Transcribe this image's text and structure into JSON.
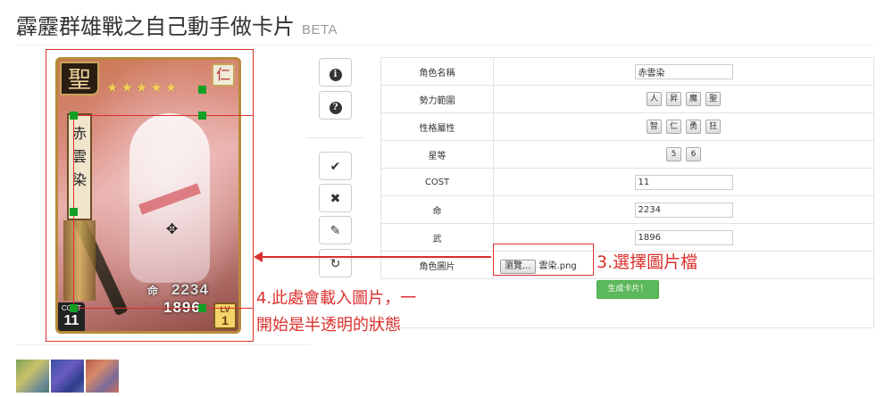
{
  "header": {
    "title": "霹靂群雄戰之自己動手做卡片",
    "badge": "BETA"
  },
  "card": {
    "holy_badge": "聖",
    "trait_badge": "仁",
    "stars": "★★★★★",
    "name_chars": [
      "赤",
      "雲",
      "染"
    ],
    "life_label": "命",
    "life_value": "2234",
    "attack_value": "1896",
    "cost_label": "COST",
    "cost_value": "11",
    "lv_label": "LV",
    "lv_value": "1"
  },
  "tools": {
    "info_icon": "info-icon",
    "help_icon": "help-icon",
    "confirm_icon": "check-icon",
    "cancel_icon": "close-icon",
    "edit_icon": "pencil-icon",
    "reset_icon": "refresh-icon"
  },
  "form": {
    "name_label": "角色名稱",
    "name_value": "赤雲染",
    "faction_label": "勢力範圍",
    "faction_options": [
      "人",
      "昇",
      "魔",
      "聖"
    ],
    "trait_label": "性格屬性",
    "trait_options": [
      "智",
      "仁",
      "勇",
      "狂"
    ],
    "rank_label": "星等",
    "rank_options": [
      "5",
      "6"
    ],
    "cost_label": "COST",
    "cost_value": "11",
    "life_label": "命",
    "life_value": "2234",
    "attack_label": "武",
    "attack_value": "1896",
    "image_label": "角色圖片",
    "browse_label": "瀏覽...",
    "file_name": "雲染.png",
    "generate_label": "生成卡片！"
  },
  "annotations": {
    "step3": "3.選擇圖片檔",
    "step4_line1": "4.此處會載入圖片，一",
    "step4_line2": "開始是半透明的狀態"
  },
  "colors": {
    "annotation_red": "#d9302c",
    "handle_green": "#12a025",
    "generate_green": "#5cb85c"
  }
}
